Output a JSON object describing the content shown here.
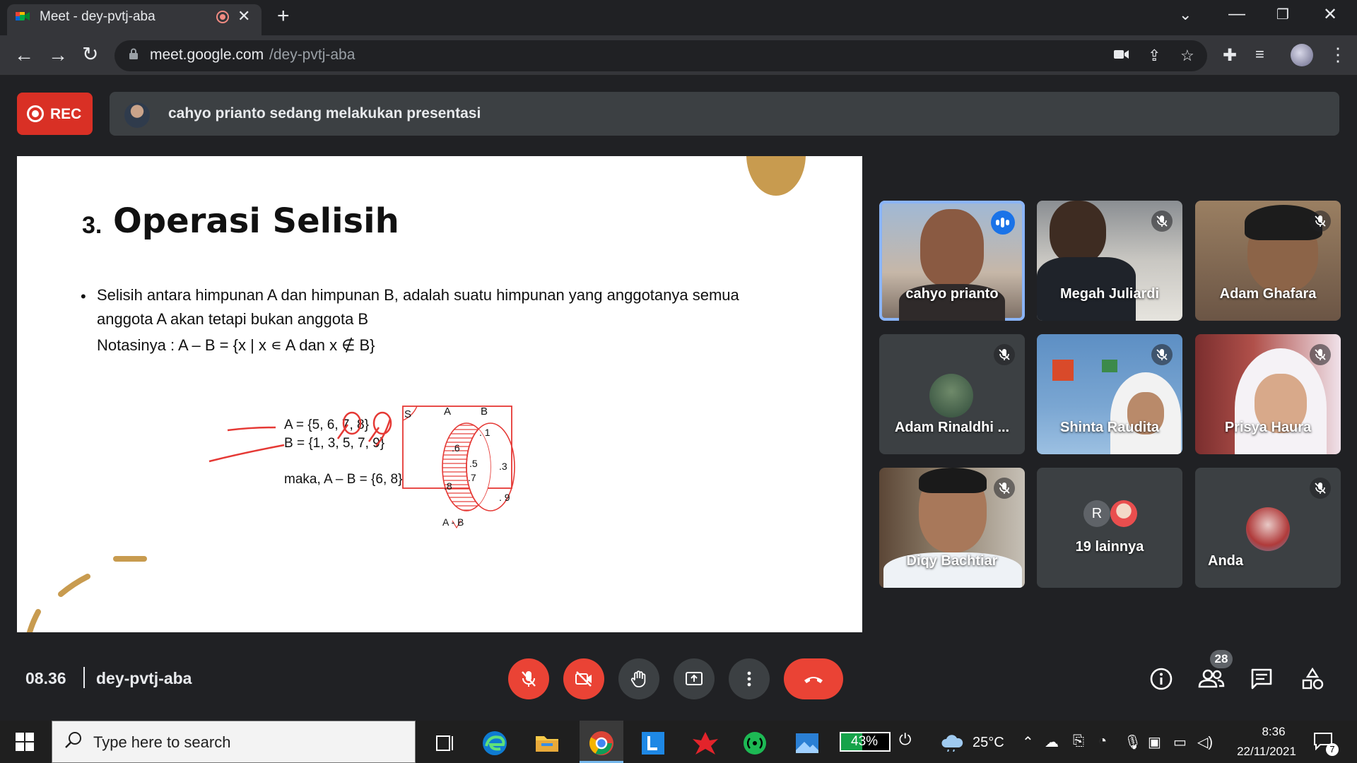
{
  "browser": {
    "tab_title": "Meet - dey-pvtj-aba",
    "new_tab": "+",
    "url_host": "meet.google.com",
    "url_path": "/dey-pvtj-aba"
  },
  "meet": {
    "rec_label": "REC",
    "presentation_banner": "cahyo prianto sedang melakukan presentasi",
    "time": "08.36",
    "meeting_code": "dey-pvtj-aba",
    "people_count": "28"
  },
  "slide": {
    "title_number": "3.",
    "title": "Operasi Selisih",
    "bullet": "•",
    "definition_line1": "Selisih antara himpunan A dan himpunan B, adalah suatu himpunan yang anggotanya semua",
    "definition_line2": "anggota A akan tetapi bukan anggota B",
    "notation": "Notasinya : A – B = {x | x ∊ A dan x ∉ B}",
    "example_a": "A   =   {5, 6, 7, 8}",
    "example_b": "B   =   {1, 3, 5, 7, 9}",
    "example_result": "maka, A – B = {6, 8}",
    "venn": {
      "universe_label": "S",
      "set_a_label": "A",
      "set_b_label": "B",
      "difference_label": "A  -  B",
      "only_a": [
        ".6",
        ".8"
      ],
      "both": [
        ".5",
        ".7"
      ],
      "only_b": [
        ". 1",
        ".3",
        ". 9"
      ]
    }
  },
  "participants": [
    {
      "name": "cahyo prianto",
      "status": "speaking"
    },
    {
      "name": "Megah Juliardi",
      "status": "muted"
    },
    {
      "name": "Adam Ghafara",
      "status": "muted"
    },
    {
      "name": "Adam Rinaldhi ...",
      "status": "muted"
    },
    {
      "name": "Shinta Raudita",
      "status": "muted"
    },
    {
      "name": "Prisya Haura",
      "status": "muted"
    },
    {
      "name": "Diqy Bachtiar",
      "status": "muted"
    },
    {
      "name": "19 lainnya",
      "avatar_letter": "R"
    },
    {
      "name": "Anda",
      "status": "muted"
    }
  ],
  "taskbar": {
    "search_placeholder": "Type here to search",
    "battery": "43%",
    "temperature": "25°C",
    "clock_time": "8:36",
    "clock_date": "22/11/2021",
    "notification_count": "7"
  },
  "colors": {
    "rec_red": "#d93025",
    "speaking_blue": "#1a73e8",
    "control_red": "#ea4335",
    "slide_accent": "#c89b4f",
    "annotation_red": "#e53935"
  }
}
